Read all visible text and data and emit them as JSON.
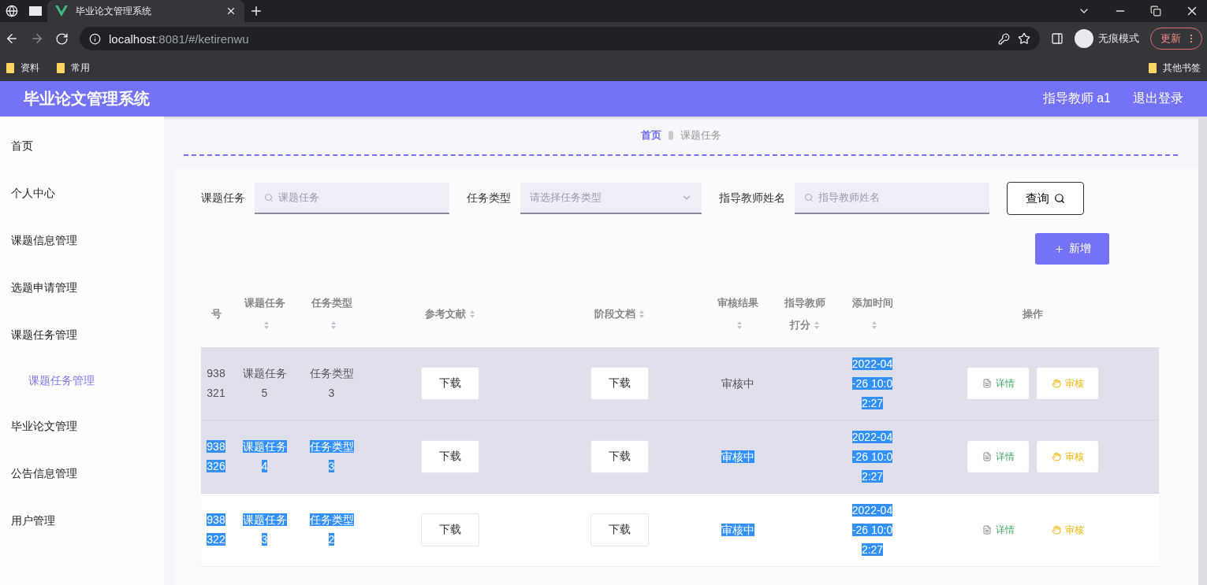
{
  "browser": {
    "tab_title": "毕业论文管理系统",
    "url_host": "localhost",
    "url_rest": ":8081/#/ketirenwu",
    "incognito_label": "无痕模式",
    "update_button": "更新",
    "bookmarks": [
      "资料",
      "常用"
    ],
    "other_bookmarks": "其他书签"
  },
  "header": {
    "title": "毕业论文管理系统",
    "user": "指导教师 a1",
    "logout": "退出登录"
  },
  "sidebar": {
    "items": [
      {
        "label": "首页",
        "selected": false
      },
      {
        "label": "个人中心",
        "selected": false
      },
      {
        "label": "课题信息管理",
        "selected": false
      },
      {
        "label": "选题申请管理",
        "selected": false
      },
      {
        "label": "课题任务管理",
        "selected": false,
        "children": [
          {
            "label": "课题任务管理",
            "selected": true
          }
        ]
      },
      {
        "label": "毕业论文管理",
        "selected": false
      },
      {
        "label": "公告信息管理",
        "selected": false
      },
      {
        "label": "用户管理",
        "selected": false
      }
    ]
  },
  "breadcrumb": {
    "home": "首页",
    "current": "课题任务"
  },
  "search": {
    "fields": [
      {
        "kind": "input",
        "label": "课题任务",
        "placeholder": "课题任务"
      },
      {
        "kind": "select",
        "label": "任务类型",
        "placeholder": "请选择任务类型"
      },
      {
        "kind": "input",
        "label": "指导教师姓名",
        "placeholder": "指导教师姓名"
      }
    ],
    "query_button": "查询"
  },
  "add_button": "新增",
  "table": {
    "columns": [
      {
        "label": "号",
        "sortable": false
      },
      {
        "label": "课题任务",
        "sortable": true
      },
      {
        "label": "任务类型",
        "sortable": true
      },
      {
        "label": "参考文献",
        "sortable": true
      },
      {
        "label": "阶段文档",
        "sortable": true
      },
      {
        "label": "审核结果",
        "sortable": true
      },
      {
        "label": "指导教师打分",
        "sortable": true
      },
      {
        "label": "添加时间",
        "sortable": true
      },
      {
        "label": "操作",
        "sortable": false
      }
    ],
    "rows": [
      {
        "shaded": true,
        "id": {
          "text": "938321",
          "highlighted": false
        },
        "topic": {
          "text": "课题任务5",
          "highlighted": false
        },
        "type": {
          "text": "任务类型3",
          "highlighted": false
        },
        "reference": "下载",
        "stage_doc": "下载",
        "status": {
          "text": "审核中",
          "highlighted": false
        },
        "time": {
          "text": "2022-04-26 10:02:27",
          "highlighted": true
        },
        "actions": [
          {
            "kind": "detail",
            "label": "详情"
          },
          {
            "kind": "review",
            "label": "审核"
          }
        ]
      },
      {
        "shaded": true,
        "id": {
          "text": "938326",
          "highlighted": true
        },
        "topic": {
          "text": "课题任务4",
          "highlighted": true
        },
        "type": {
          "text": "任务类型3",
          "highlighted": true
        },
        "reference": "下载",
        "stage_doc": "下载",
        "status": {
          "text": "审核中",
          "highlighted": true
        },
        "time": {
          "text": "2022-04-26 10:02:27",
          "highlighted": true
        },
        "actions": [
          {
            "kind": "detail",
            "label": "详情"
          },
          {
            "kind": "review",
            "label": "审核"
          }
        ]
      },
      {
        "shaded": false,
        "id": {
          "text": "938322",
          "highlighted": true
        },
        "topic": {
          "text": "课题任务3",
          "highlighted": true
        },
        "type": {
          "text": "任务类型2",
          "highlighted": true
        },
        "reference": "下载",
        "stage_doc": "下载",
        "status": {
          "text": "审核中",
          "highlighted": true
        },
        "time": {
          "text": "2022-04-26 10:02:27",
          "highlighted": true
        },
        "actions": [
          {
            "kind": "detail",
            "label": "详情"
          },
          {
            "kind": "review",
            "label": "审核"
          }
        ]
      }
    ]
  }
}
